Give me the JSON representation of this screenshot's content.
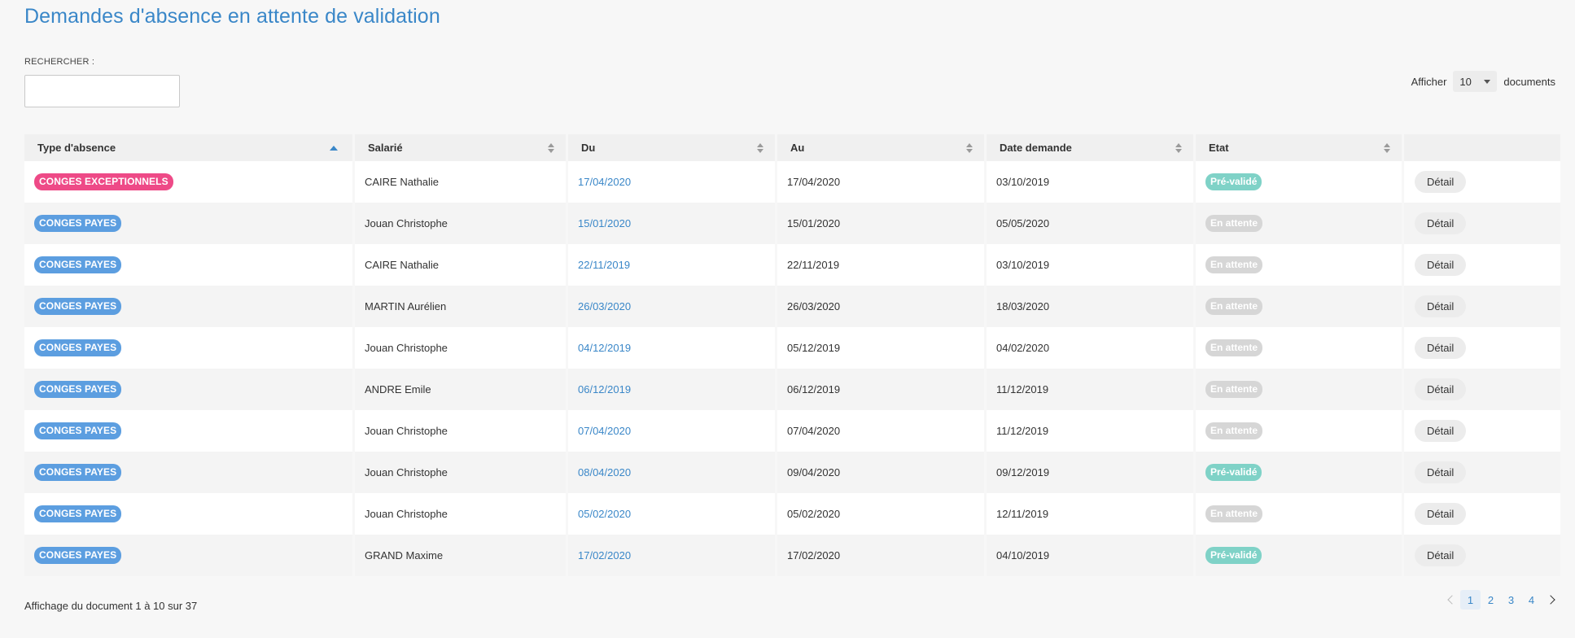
{
  "title": "Demandes d'absence en attente de validation",
  "search": {
    "label": "RECHERCHER :",
    "value": "",
    "placeholder": ""
  },
  "show": {
    "prefix": "Afficher",
    "value": "10",
    "suffix": "documents"
  },
  "columns": [
    "Type d'absence",
    "Salarié",
    "Du",
    "Au",
    "Date demande",
    "Etat",
    ""
  ],
  "rows": [
    {
      "type": "CONGES EXCEPTIONNELS",
      "type_kind": "excep",
      "employee": "CAIRE Nathalie",
      "from": "17/04/2020",
      "to": "17/04/2020",
      "requested": "03/10/2019",
      "state": "Pré-validé",
      "state_kind": "pre",
      "action": "Détail"
    },
    {
      "type": "CONGES PAYES",
      "type_kind": "payes",
      "employee": "Jouan Christophe",
      "from": "15/01/2020",
      "to": "15/01/2020",
      "requested": "05/05/2020",
      "state": "En attente",
      "state_kind": "wait",
      "action": "Détail"
    },
    {
      "type": "CONGES PAYES",
      "type_kind": "payes",
      "employee": "CAIRE Nathalie",
      "from": "22/11/2019",
      "to": "22/11/2019",
      "requested": "03/10/2019",
      "state": "En attente",
      "state_kind": "wait",
      "action": "Détail"
    },
    {
      "type": "CONGES PAYES",
      "type_kind": "payes",
      "employee": "MARTIN Aurélien",
      "from": "26/03/2020",
      "to": "26/03/2020",
      "requested": "18/03/2020",
      "state": "En attente",
      "state_kind": "wait",
      "action": "Détail"
    },
    {
      "type": "CONGES PAYES",
      "type_kind": "payes",
      "employee": "Jouan Christophe",
      "from": "04/12/2019",
      "to": "05/12/2019",
      "requested": "04/02/2020",
      "state": "En attente",
      "state_kind": "wait",
      "action": "Détail"
    },
    {
      "type": "CONGES PAYES",
      "type_kind": "payes",
      "employee": "ANDRE Emile",
      "from": "06/12/2019",
      "to": "06/12/2019",
      "requested": "11/12/2019",
      "state": "En attente",
      "state_kind": "wait",
      "action": "Détail"
    },
    {
      "type": "CONGES PAYES",
      "type_kind": "payes",
      "employee": "Jouan Christophe",
      "from": "07/04/2020",
      "to": "07/04/2020",
      "requested": "11/12/2019",
      "state": "En attente",
      "state_kind": "wait",
      "action": "Détail"
    },
    {
      "type": "CONGES PAYES",
      "type_kind": "payes",
      "employee": "Jouan Christophe",
      "from": "08/04/2020",
      "to": "09/04/2020",
      "requested": "09/12/2019",
      "state": "Pré-validé",
      "state_kind": "pre",
      "action": "Détail"
    },
    {
      "type": "CONGES PAYES",
      "type_kind": "payes",
      "employee": "Jouan Christophe",
      "from": "05/02/2020",
      "to": "05/02/2020",
      "requested": "12/11/2019",
      "state": "En attente",
      "state_kind": "wait",
      "action": "Détail"
    },
    {
      "type": "CONGES PAYES",
      "type_kind": "payes",
      "employee": "GRAND Maxime",
      "from": "17/02/2020",
      "to": "17/02/2020",
      "requested": "04/10/2019",
      "state": "Pré-validé",
      "state_kind": "pre",
      "action": "Détail"
    }
  ],
  "footer": {
    "info": "Affichage du document 1 à 10 sur 37"
  },
  "pagination": {
    "pages": [
      "1",
      "2",
      "3",
      "4"
    ],
    "current": "1"
  },
  "colors": {
    "accent": "#3a87c8",
    "payes": "#5c9ee0",
    "excep": "#ee4a87",
    "pre_validated": "#7fd2c7",
    "pending": "#d6d6d6"
  },
  "icons": {
    "sort": "sort-icon",
    "sort_asc": "sort-asc-icon",
    "dropdown": "caret-down-icon",
    "prev": "chevron-left-icon",
    "next": "chevron-right-icon"
  }
}
